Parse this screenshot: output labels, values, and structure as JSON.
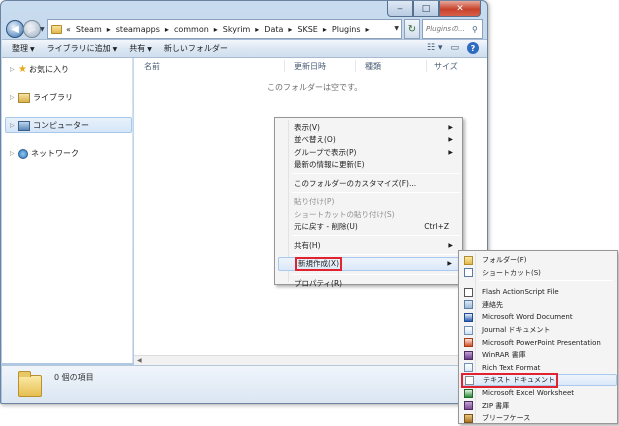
{
  "window": {
    "caption_min": "‒",
    "caption_max": "□",
    "caption_close": "✕"
  },
  "nav": {
    "back_glyph": "◀",
    "forward_glyph": "▶"
  },
  "address": {
    "prefix": "«",
    "crumbs": [
      "Steam",
      "steamapps",
      "common",
      "Skyrim",
      "Data",
      "SKSE",
      "Plugins"
    ],
    "separator": "▸"
  },
  "search": {
    "placeholder": "Pluginsの..."
  },
  "commandbar": {
    "items": [
      "整理",
      "ライブラリに追加",
      "共有",
      "新しいフォルダー"
    ],
    "dropdown_flags": [
      true,
      true,
      true,
      false
    ]
  },
  "navpane": {
    "items": [
      {
        "label": "お気に入り",
        "icon": "star-icon"
      },
      {
        "label": "ライブラリ",
        "icon": "library-icon"
      },
      {
        "label": "コンピューター",
        "icon": "computer-icon"
      },
      {
        "label": "ネットワーク",
        "icon": "network-icon"
      }
    ],
    "selected": "コンピューター"
  },
  "content": {
    "columns": [
      "名前",
      "更新日時",
      "種類",
      "サイズ"
    ],
    "empty_message": "このフォルダーは空です。"
  },
  "details": {
    "item_count": "0 個の項目"
  },
  "context_menu": {
    "items": [
      {
        "label": "表示(V)",
        "submenu": true
      },
      {
        "label": "並べ替え(O)",
        "submenu": true
      },
      {
        "label": "グループで表示(P)",
        "submenu": true
      },
      {
        "label": "最新の情報に更新(E)"
      },
      {
        "separator": true
      },
      {
        "label": "このフォルダーのカスタマイズ(F)..."
      },
      {
        "separator": true
      },
      {
        "label": "貼り付け(P)",
        "disabled": true
      },
      {
        "label": "ショートカットの貼り付け(S)",
        "disabled": true
      },
      {
        "label": "元に戻す - 削除(U)",
        "shortcut": "Ctrl+Z"
      },
      {
        "separator": true
      },
      {
        "label": "共有(H)",
        "submenu": true
      },
      {
        "separator": true
      },
      {
        "label": "新規作成(X)",
        "submenu": true,
        "highlighted": true
      },
      {
        "separator": true
      },
      {
        "label": "プロパティ(R)"
      }
    ]
  },
  "new_submenu": {
    "items": [
      {
        "label": "フォルダー(F)",
        "icon": "folder-icon"
      },
      {
        "label": "ショートカット(S)",
        "icon": "shortcut-icon"
      },
      {
        "separator": true
      },
      {
        "label": "Flash ActionScript File",
        "icon": "actionscript-file-icon"
      },
      {
        "label": "連絡先",
        "icon": "contact-icon"
      },
      {
        "label": "Microsoft Word Document",
        "icon": "word-icon"
      },
      {
        "label": "Journal ドキュメント",
        "icon": "journal-icon"
      },
      {
        "label": "Microsoft PowerPoint Presentation",
        "icon": "powerpoint-icon"
      },
      {
        "label": "WinRAR 書庫",
        "icon": "winrar-icon"
      },
      {
        "label": "Rich Text Format",
        "icon": "rtf-icon"
      },
      {
        "label": "テキスト ドキュメント",
        "icon": "text-document-icon",
        "highlighted": true
      },
      {
        "label": "Microsoft Excel Worksheet",
        "icon": "excel-icon"
      },
      {
        "label": "ZIP 書庫",
        "icon": "zip-icon"
      },
      {
        "label": "ブリーフケース",
        "icon": "briefcase-icon"
      }
    ]
  },
  "colors": {
    "highlight_box": "#e0232f",
    "menu_hover": "#dce9f9",
    "frame": "#b9cfe6"
  }
}
